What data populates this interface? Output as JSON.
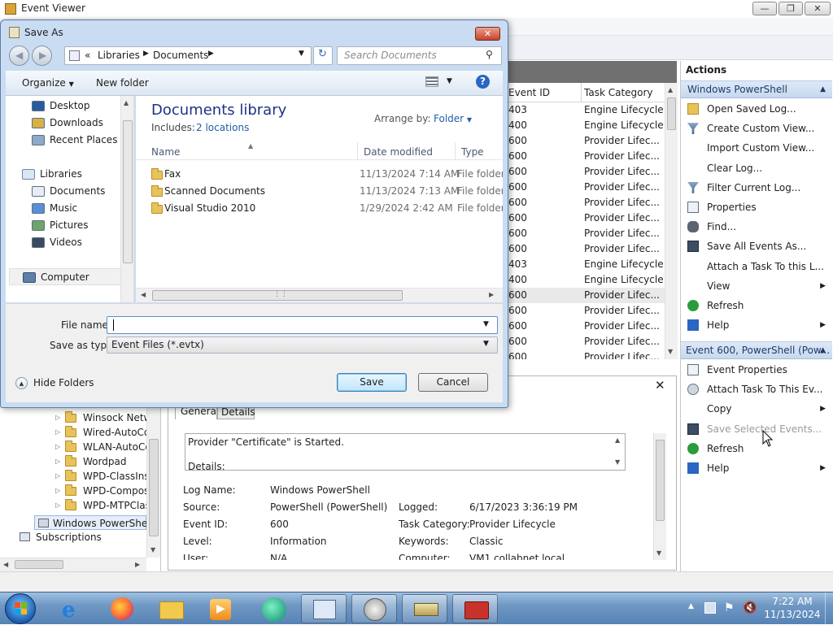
{
  "event_viewer": {
    "title": "Event Viewer",
    "list": {
      "columns": [
        "Event ID",
        "Task Category"
      ],
      "rows": [
        {
          "id": "403",
          "category": "Engine Lifecycle"
        },
        {
          "id": "400",
          "category": "Engine Lifecycle"
        },
        {
          "id": "600",
          "category": "Provider Lifec..."
        },
        {
          "id": "600",
          "category": "Provider Lifec..."
        },
        {
          "id": "600",
          "category": "Provider Lifec..."
        },
        {
          "id": "600",
          "category": "Provider Lifec..."
        },
        {
          "id": "600",
          "category": "Provider Lifec..."
        },
        {
          "id": "600",
          "category": "Provider Lifec..."
        },
        {
          "id": "600",
          "category": "Provider Lifec..."
        },
        {
          "id": "600",
          "category": "Provider Lifec..."
        },
        {
          "id": "403",
          "category": "Engine Lifecycle"
        },
        {
          "id": "400",
          "category": "Engine Lifecycle"
        },
        {
          "id": "600",
          "category": "Provider Lifec..."
        },
        {
          "id": "600",
          "category": "Provider Lifec..."
        },
        {
          "id": "600",
          "category": "Provider Lifec..."
        },
        {
          "id": "600",
          "category": "Provider Lifec..."
        },
        {
          "id": "600",
          "category": "Provider Lifec..."
        }
      ]
    },
    "actions": {
      "header": "Actions",
      "section1_title": "Windows PowerShell",
      "section1_items": [
        {
          "label": "Open Saved Log...",
          "icon": "folder-open-icon",
          "arrow": false
        },
        {
          "label": "Create Custom View...",
          "icon": "filter-icon",
          "arrow": false
        },
        {
          "label": "Import Custom View...",
          "icon": "",
          "arrow": false
        },
        {
          "label": "Clear Log...",
          "icon": "",
          "arrow": false
        },
        {
          "label": "Filter Current Log...",
          "icon": "filter-icon",
          "arrow": false
        },
        {
          "label": "Properties",
          "icon": "properties-icon",
          "arrow": false
        },
        {
          "label": "Find...",
          "icon": "binoculars-icon",
          "arrow": false
        },
        {
          "label": "Save All Events As...",
          "icon": "save-icon",
          "arrow": false
        },
        {
          "label": "Attach a Task To this L...",
          "icon": "",
          "arrow": false
        },
        {
          "label": "View",
          "icon": "",
          "arrow": true
        },
        {
          "label": "Refresh",
          "icon": "refresh-icon",
          "arrow": false
        },
        {
          "label": "Help",
          "icon": "help-icon",
          "arrow": true
        }
      ],
      "section2_title": "Event 600, PowerShell (Pow...",
      "section2_items": [
        {
          "label": "Event Properties",
          "icon": "properties-icon",
          "arrow": false,
          "disabled": false
        },
        {
          "label": "Attach Task To This Ev...",
          "icon": "task-icon",
          "arrow": false,
          "disabled": false
        },
        {
          "label": "Copy",
          "icon": "",
          "arrow": true,
          "disabled": false
        },
        {
          "label": "Save Selected Events...",
          "icon": "save-icon",
          "arrow": false,
          "disabled": true
        },
        {
          "label": "Refresh",
          "icon": "refresh-icon",
          "arrow": false,
          "disabled": false
        },
        {
          "label": "Help",
          "icon": "help-icon",
          "arrow": true,
          "disabled": false
        }
      ]
    },
    "tree": {
      "items": [
        "Winsock Netw",
        "Wired-AutoCo",
        "WLAN-AutoCo",
        "Wordpad",
        "WPD-ClassInst",
        "WPD-Compos",
        "WPD-MTPClas"
      ],
      "selected": "Windows PowerShell",
      "subscriptions": "Subscriptions"
    },
    "detail": {
      "tab_general": "General",
      "tab_details": "Details",
      "message": "Provider \"Certificate\" is Started.",
      "message_details": "Details:",
      "log_name_label": "Log Name:",
      "log_name": "Windows PowerShell",
      "source_label": "Source:",
      "source": "PowerShell (PowerShell)",
      "logged_label": "Logged:",
      "logged": "6/17/2023 3:36:19 PM",
      "event_id_label": "Event ID:",
      "event_id": "600",
      "task_category_label": "Task Category:",
      "task_category": "Provider Lifecycle",
      "level_label": "Level:",
      "level": "Information",
      "keywords_label": "Keywords:",
      "keywords": "Classic",
      "user_label": "User:",
      "user": "N/A",
      "computer_label": "Computer:",
      "computer": "VM1.collabnet.local"
    }
  },
  "save_as": {
    "title": "Save As",
    "breadcrumb": [
      "Libraries",
      "Documents"
    ],
    "search_placeholder": "Search Documents",
    "organize": "Organize",
    "new_folder": "New folder",
    "nav": {
      "favorites": [
        "Desktop",
        "Downloads",
        "Recent Places"
      ],
      "libraries_label": "Libraries",
      "libraries": [
        "Documents",
        "Music",
        "Pictures",
        "Videos"
      ],
      "computer": "Computer"
    },
    "library_title": "Documents library",
    "includes_label": "Includes:",
    "includes_link": "2 locations",
    "arrange_by_label": "Arrange by:",
    "arrange_by_value": "Folder",
    "columns": {
      "name": "Name",
      "date": "Date modified",
      "type": "Type"
    },
    "files": [
      {
        "name": "Fax",
        "date": "11/13/2024 7:14 AM",
        "type": "File folder"
      },
      {
        "name": "Scanned Documents",
        "date": "11/13/2024 7:13 AM",
        "type": "File folder"
      },
      {
        "name": "Visual Studio 2010",
        "date": "1/29/2024 2:42 AM",
        "type": "File folder"
      }
    ],
    "file_name_label": "File name:",
    "file_name_value": "",
    "save_as_type_label": "Save as type:",
    "save_as_type_value": "Event Files (*.evtx)",
    "hide_folders": "Hide Folders",
    "save_button": "Save",
    "cancel_button": "Cancel"
  },
  "taskbar": {
    "time": "7:22 AM",
    "date": "11/13/2024"
  }
}
